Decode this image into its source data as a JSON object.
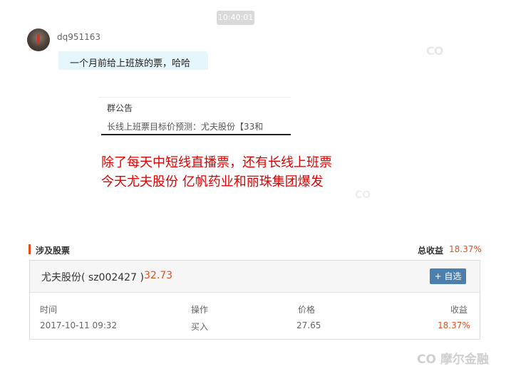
{
  "chat": {
    "timestamp": "10:40:01",
    "username": "dq951163",
    "message": "一个月前给上班族的票，哈哈"
  },
  "notice": {
    "title": "群公告",
    "body": "长线上班票目标价预测：尤夫股份【33和"
  },
  "annotation": {
    "line1": "除了每天中短线直播票，还有长线上班票",
    "line2": "今天尤夫股份 亿帆药业和丽珠集团爆发"
  },
  "stocks": {
    "section_title": "涉及股票",
    "total_label": "总收益",
    "total_value": "18.37%",
    "name": "尤夫股份( sz002427 )",
    "price": "32.73",
    "add_button": "+ 自选",
    "headers": {
      "time": "时间",
      "action": "操作",
      "price": "价格",
      "return": "收益"
    },
    "row": {
      "time": "2017-10-11 09:32",
      "action": "买入",
      "price": "27.65",
      "return": "18.37%"
    }
  },
  "watermark": {
    "text": "CO 摩尔金融"
  },
  "colors": {
    "accent": "#e84e1b",
    "button": "#4a7fae",
    "annotation_red": "#e00000",
    "bubble": "#e6f6fd"
  }
}
